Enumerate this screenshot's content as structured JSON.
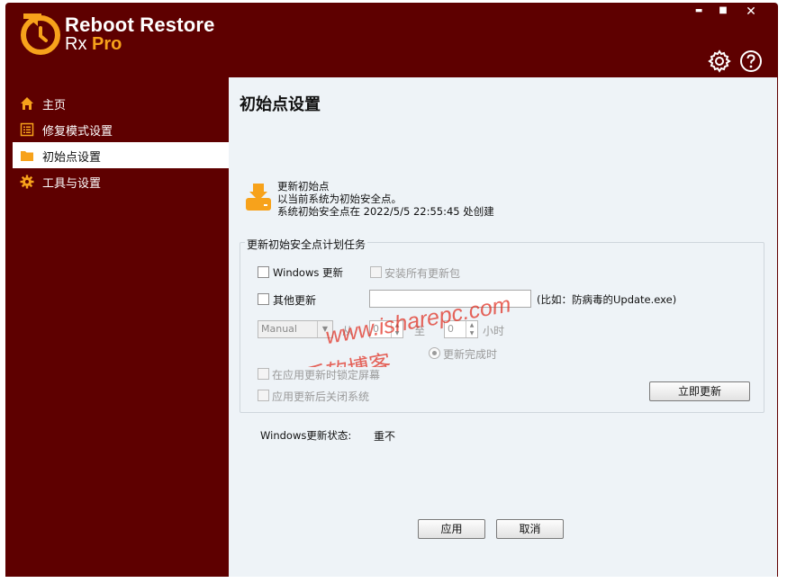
{
  "app": {
    "name": "Reboot Restore",
    "edition_prefix": "Rx",
    "edition_suffix": "Pro",
    "accent_color": "#f7a21b",
    "frame_color": "#5e0000"
  },
  "window_controls": {
    "minimize": "▬",
    "maximize": "■",
    "close": "✕"
  },
  "toolbar": {
    "settings_icon": "gear-icon",
    "help_icon": "help-icon"
  },
  "sidebar": {
    "items": [
      {
        "label": "主页",
        "icon": "home-icon"
      },
      {
        "label": "修复模式设置",
        "icon": "list-icon"
      },
      {
        "label": "初始点设置",
        "icon": "folder-icon",
        "active": true
      },
      {
        "label": "工具与设置",
        "icon": "gear-icon"
      }
    ]
  },
  "page": {
    "title": "初始点设置",
    "info": {
      "line1": "更新初始点",
      "line2": "以当前系统为初始安全点。",
      "line3": "系统初始安全点在 2022/5/5 22:55:45 处创建"
    },
    "schedule": {
      "group_title": "更新初始安全点计划任务",
      "windows_update_label": "Windows 更新",
      "install_all_label": "安装所有更新包",
      "other_update_label": "其他更新",
      "other_update_value": "",
      "example_hint": "(比如：防病毒的Update.exe)",
      "frequency_value": "Manual",
      "from_label": "从",
      "from_value": "0",
      "to_label": "至",
      "to_value": "0",
      "hours_label": "小时",
      "after_update_label": "更新完成时",
      "lock_screen_label": "在应用更新时锁定屏幕",
      "shutdown_label": "应用更新后关闭系统",
      "update_now_button": "立即更新"
    },
    "status": {
      "label": "Windows更新状态:",
      "value": "重不"
    },
    "buttons": {
      "apply": "应用",
      "cancel": "取消"
    }
  },
  "watermark": {
    "line1": "www.isharepc.com",
    "line2": "乐软博客"
  }
}
